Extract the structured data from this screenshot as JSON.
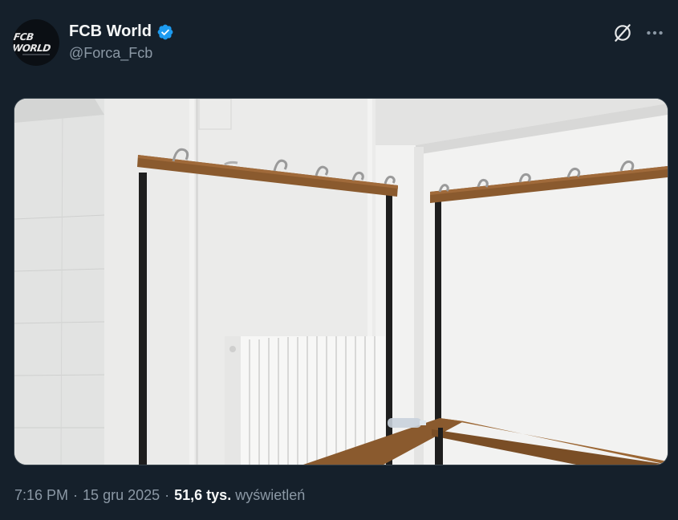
{
  "author": {
    "display_name": "FCB World",
    "handle": "@Forca_Fcb",
    "avatar_text": "FCB WORLD",
    "verified": true
  },
  "icons": {
    "verified": "verified-badge-icon",
    "grok": "grok-icon",
    "more": "more-options-icon"
  },
  "media": {
    "type": "video-still",
    "subject": "locker-room-coat-racks"
  },
  "meta": {
    "time": "7:16 PM",
    "date": "15 gru 2025",
    "views_count": "51,6 tys.",
    "views_label": "wyświetleń",
    "separator": "·"
  },
  "colors": {
    "background": "#15202b",
    "text_primary": "#f7f9f9",
    "text_secondary": "#8b98a5",
    "verified_blue": "#1d9bf0"
  }
}
